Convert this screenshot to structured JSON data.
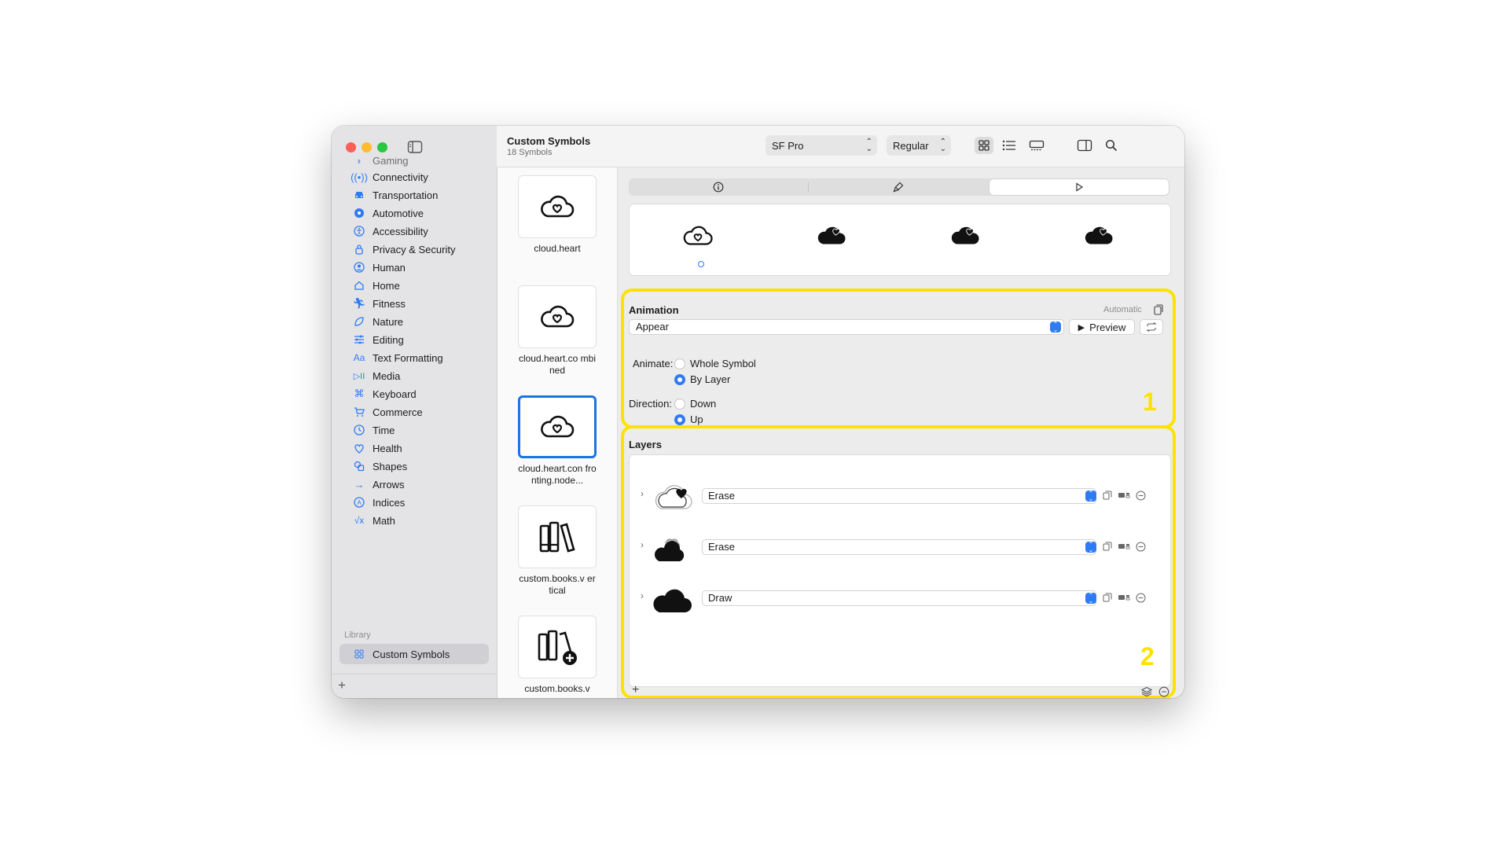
{
  "sidebar": {
    "partial_item": "Gaming",
    "items": [
      {
        "label": "Connectivity",
        "icon": "antenna-icon"
      },
      {
        "label": "Transportation",
        "icon": "car-icon"
      },
      {
        "label": "Automotive",
        "icon": "steering-wheel-icon"
      },
      {
        "label": "Accessibility",
        "icon": "accessibility-icon"
      },
      {
        "label": "Privacy & Security",
        "icon": "lock-icon"
      },
      {
        "label": "Human",
        "icon": "person-icon"
      },
      {
        "label": "Home",
        "icon": "house-icon"
      },
      {
        "label": "Fitness",
        "icon": "figure-run-icon"
      },
      {
        "label": "Nature",
        "icon": "leaf-icon"
      },
      {
        "label": "Editing",
        "icon": "sliders-icon"
      },
      {
        "label": "Text Formatting",
        "icon": "textformat-icon"
      },
      {
        "label": "Media",
        "icon": "play-pause-icon"
      },
      {
        "label": "Keyboard",
        "icon": "command-icon"
      },
      {
        "label": "Commerce",
        "icon": "cart-icon"
      },
      {
        "label": "Time",
        "icon": "clock-icon"
      },
      {
        "label": "Health",
        "icon": "heart-icon"
      },
      {
        "label": "Shapes",
        "icon": "shapes-icon"
      },
      {
        "label": "Arrows",
        "icon": "arrow-right-icon"
      },
      {
        "label": "Indices",
        "icon": "a-circle-icon"
      },
      {
        "label": "Math",
        "icon": "squareroot-icon"
      }
    ],
    "library_header": "Library",
    "library_item": "Custom Symbols"
  },
  "toolbar": {
    "title": "Custom Symbols",
    "subtitle": "18 Symbols",
    "font_popup": "SF Pro",
    "weight_popup": "Regular"
  },
  "symbols": [
    {
      "name": "cloud.heart"
    },
    {
      "name": "cloud.heart.co mbined"
    },
    {
      "name": "cloud.heart.con fronting.node..."
    },
    {
      "name": "custom.books.v ertical"
    },
    {
      "name": "custom.books.v"
    }
  ],
  "animation": {
    "title": "Animation",
    "auto_label": "Automatic",
    "effect": "Appear",
    "preview_label": "Preview",
    "animate_label": "Animate:",
    "animate_options": [
      "Whole Symbol",
      "By Layer"
    ],
    "animate_selected": "By Layer",
    "direction_label": "Direction:",
    "direction_options": [
      "Down",
      "Up"
    ],
    "direction_selected": "Up",
    "callout": "1"
  },
  "layers": {
    "title": "Layers",
    "rows": [
      {
        "action": "Erase"
      },
      {
        "action": "Erase"
      },
      {
        "action": "Draw"
      }
    ],
    "callout": "2"
  },
  "colors": {
    "accent": "#2f7bf5",
    "highlight": "#fde200",
    "selection_border": "#1a73e8"
  }
}
